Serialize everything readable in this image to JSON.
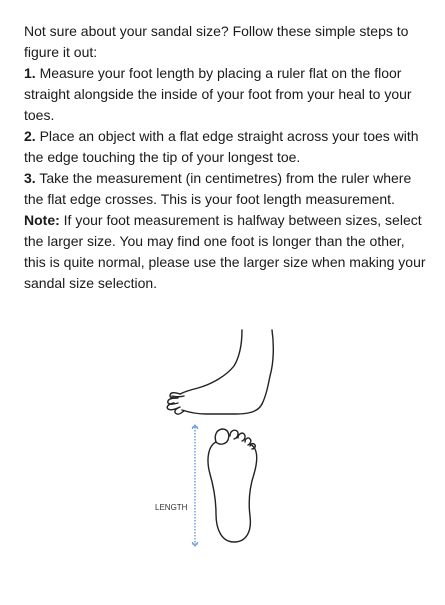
{
  "intro": "Not sure about your sandal size? Follow these simple steps to figure it out:",
  "steps": [
    {
      "number": "1.",
      "text": " Measure your foot length by placing a ruler flat on the floor straight alongside the inside of your foot from your heal to your toes."
    },
    {
      "number": "2.",
      "text": " Place an object with a flat edge straight across your toes with the edge touching the tip of your longest toe."
    },
    {
      "number": "3.",
      "text": " Take the measurement (in centimetres) from the ruler where the flat edge crosses. This is your foot length measurement."
    }
  ],
  "note": {
    "label": "Note:",
    "text": " If your foot measurement is halfway between sizes, select the larger size. You may find one foot is longer than the other, this is quite normal, please use the larger size when making your sandal size selection."
  },
  "diagram": {
    "length_label": "LENGTH"
  }
}
